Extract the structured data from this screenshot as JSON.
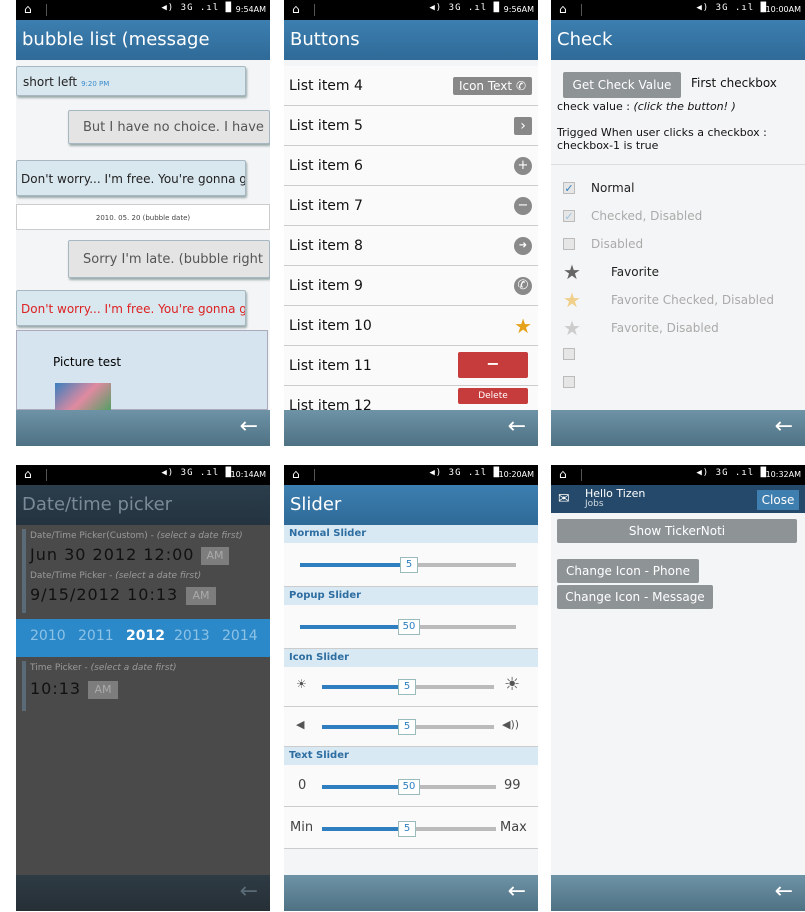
{
  "status": {
    "home_icon": "home-icon",
    "indicators": "◀) 3G .ıl █",
    "times": [
      "9:54AM",
      "9:56AM",
      "10:00AM",
      "10:14AM",
      "10:20AM",
      "10:32AM"
    ]
  },
  "footer": {
    "back_icon": "back-arrow-icon",
    "back_glyph": "←"
  },
  "bubble": {
    "title": "bubble list (message bubble)",
    "b1": "short left",
    "b1_time": "9:20 PM",
    "b2": "But I have no choice. I have",
    "b3": "Don't worry... I'm free. You're gonna get",
    "date": "2010. 05. 20 (bubble date)",
    "b4": "Sorry I'm late. (bubble right",
    "b5": "Don't worry... I'm free. You're gonna get",
    "pic": "Picture test"
  },
  "buttons": {
    "title": "Buttons",
    "items": [
      "List item 4",
      "List item 5",
      "List item 6",
      "List item 7",
      "List item 8",
      "List item 9",
      "List item 10",
      "List item 11",
      "List item 12"
    ],
    "icon_text": "Icon Text",
    "delete": "Delete",
    "minus": "−",
    "chevron": "›",
    "plus": "+",
    "circle_minus": "−",
    "forward": "➜",
    "phone": "✆",
    "star": "★"
  },
  "check": {
    "title": "Check",
    "get_btn": "Get Check Value",
    "first_label": "First checkbox",
    "value_text": "check value : ",
    "value_hint": "(click the button! )",
    "trig1": "Trigged When user clicks a checkbox :",
    "trig2": "checkbox-1 is true",
    "items": [
      {
        "label": "Normal",
        "checked": true,
        "disabled": false
      },
      {
        "label": "Checked, Disabled",
        "checked": true,
        "disabled": true
      },
      {
        "label": "Disabled",
        "checked": false,
        "disabled": true
      }
    ],
    "favorites": [
      "Favorite",
      "Favorite Checked, Disabled",
      "Favorite, Disabled"
    ],
    "checkmark": "✓",
    "star": "★"
  },
  "picker": {
    "title": "Date/time picker",
    "l1": "Date/Time Picker(Custom) - ",
    "l1_hint": "(select a date first)",
    "v1": "Jun 30  2012    12:00",
    "l2": "Date/Time Picker - ",
    "l2_hint": "(select a date first)",
    "v2": "9/15/2012     10:13",
    "years": [
      "2010",
      "2011",
      "2012",
      "2013",
      "2014"
    ],
    "selected_year": "2012",
    "l3": "Time Picker - ",
    "l3_hint": "(select a date first)",
    "v3": "10:13",
    "am": "AM"
  },
  "slider": {
    "title": "Slider",
    "normal": "Normal Slider",
    "popup": "Popup Slider",
    "icon": "Icon Slider",
    "text": "Text Slider",
    "values": {
      "normal": "5",
      "popup": "50",
      "brightness": "5",
      "volume": "5",
      "text": "50",
      "minmax": "5"
    },
    "min_num": "0",
    "max_num": "99",
    "min_word": "Min",
    "max_word": "Max",
    "sun_small": "☀",
    "sun_big": "☀",
    "vol_low": "◀",
    "vol_high": "◀))"
  },
  "ticker": {
    "notif_title": "Hello Tizen",
    "notif_sub": "Jobs",
    "envelope": "✉",
    "close": "Close",
    "show": "Show TickerNoti",
    "phone": "Change Icon - Phone",
    "message": "Change Icon - Message"
  }
}
